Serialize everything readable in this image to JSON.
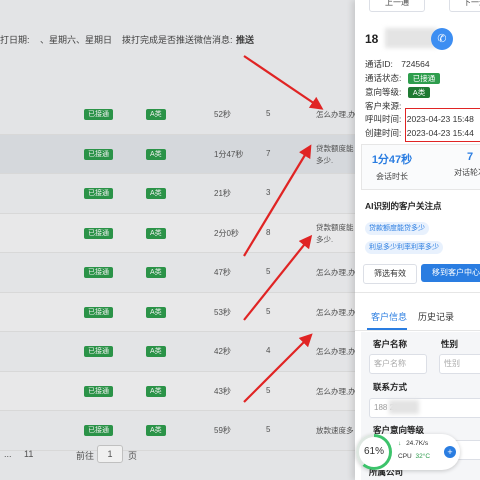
{
  "filter": {
    "dial_days_label": "打日期:",
    "dial_days_value": "、星期六、星期日",
    "wechat_label": "拨打完成是否推送微信消息:",
    "wechat_value": "推送"
  },
  "rows": [
    {
      "status": "已接通",
      "level": "A类",
      "duration": "52秒",
      "rounds": "5",
      "question": "怎么办理,办"
    },
    {
      "status": "已接通",
      "level": "A类",
      "duration": "1分47秒",
      "rounds": "7",
      "question": "贷款额度能\n多少."
    },
    {
      "status": "已接通",
      "level": "A类",
      "duration": "21秒",
      "rounds": "3",
      "question": ""
    },
    {
      "status": "已接通",
      "level": "A类",
      "duration": "2分0秒",
      "rounds": "8",
      "question": "贷款额度能\n多少."
    },
    {
      "status": "已接通",
      "level": "A类",
      "duration": "47秒",
      "rounds": "5",
      "question": "怎么办理,办"
    },
    {
      "status": "已接通",
      "level": "A类",
      "duration": "53秒",
      "rounds": "5",
      "question": "怎么办理,办"
    },
    {
      "status": "已接通",
      "level": "A类",
      "duration": "42秒",
      "rounds": "4",
      "question": "怎么办理,办"
    },
    {
      "status": "已接通",
      "level": "A类",
      "duration": "43秒",
      "rounds": "5",
      "question": "怎么办理,办"
    },
    {
      "status": "已接通",
      "level": "A类",
      "duration": "59秒",
      "rounds": "5",
      "question": "放款速度多"
    }
  ],
  "pager": {
    "dots": "...",
    "last": "11",
    "goto": "前往",
    "page": "1",
    "unit": "页"
  },
  "drawer": {
    "prev": "上一通",
    "next": "下一通",
    "phone_prefix": "18",
    "call_id_label": "通话ID:",
    "call_id": "724564",
    "call_status_label": "通话状态:",
    "call_status": "已接通",
    "intent_label": "意向等级:",
    "intent": "A类",
    "source_label": "客户来源:",
    "source": "",
    "call_time_label": "呼叫时间:",
    "call_time": "2023-04-23 15:48",
    "create_time_label": "创建时间:",
    "create_time": "2023-04-23 15:44",
    "duration_value": "1分47秒",
    "duration_label": "会话时长",
    "rounds_value": "7",
    "rounds_label": "对话轮次",
    "ai_title": "AI识别的客户关注点",
    "keywords": [
      "贷款额度能贷多少",
      "利息多少利率利率多少"
    ],
    "filter_btn": "筛选有效",
    "move_btn": "移到客户中心",
    "tab_info": "客户信息",
    "tab_history": "历史记录",
    "name_label": "客户名称",
    "name_placeholder": "客户名称",
    "gender_label": "性别",
    "gender_placeholder": "性别",
    "contact_label": "联系方式",
    "contact_value": "188        29",
    "level_label": "客户意向等级",
    "last_label": "所属公司"
  },
  "cpu": {
    "percent": "61%",
    "percent_value": 61,
    "net_up": "↑",
    "net_down": "↓",
    "net_speed": "24.7K/s",
    "cpu_label": "CPU",
    "temp": "32°C"
  },
  "colors": {
    "accent": "#2a7de1",
    "tag_green": "#2e9d4d",
    "highlight_red": "#e02424"
  }
}
